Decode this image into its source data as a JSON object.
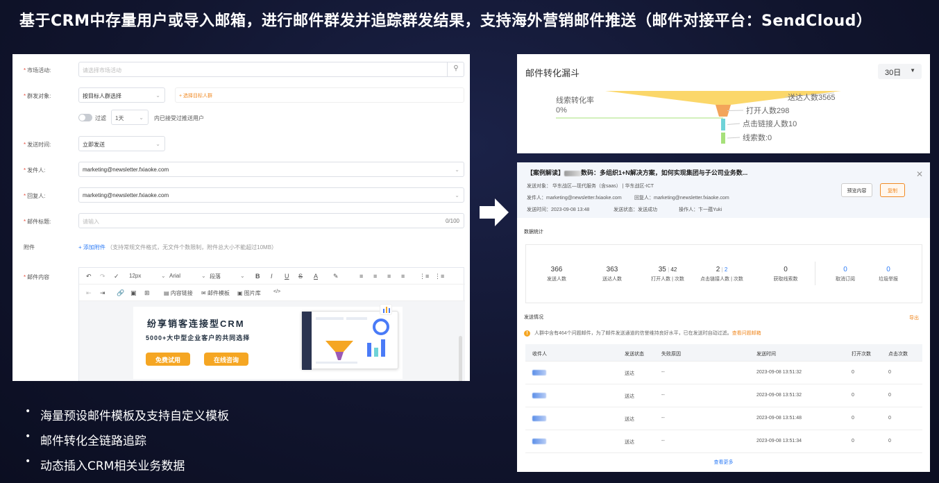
{
  "headline": "基于CRM中存量用户或导入邮箱，进行邮件群发并追踪群发结果，支持海外营销邮件推送（邮件对接平台：SendCloud）",
  "form": {
    "activity_label": "市场活动:",
    "activity_placeholder": "请选择市场活动",
    "target_label": "群发对象:",
    "target_value": "按目标人群选择",
    "target_link": "+ 选择目标人群",
    "filter_label": "过滤",
    "filter_days": "1天",
    "filter_note": "内已接受过推送用户",
    "time_label": "发送时间:",
    "time_value": "立即发送",
    "sender_label": "发件人:",
    "sender_value": "marketing@newsletter.fxiaoke.com",
    "reply_label": "回复人:",
    "reply_value": "marketing@newsletter.fxiaoke.com",
    "subject_label": "邮件标题:",
    "subject_placeholder": "请输入",
    "subject_count": "0/100",
    "attach_label": "附件",
    "attach_link": "+ 添加附件",
    "attach_note": "（支持常规文件格式，无文件个数限制，附件总大小不能超过10MB）",
    "content_label": "邮件内容",
    "toolbar": {
      "font_size": "12px",
      "font_family": "Arial",
      "paragraph": "段落",
      "content_link": "内容链接",
      "mail_template": "邮件模板",
      "image_lib": "图片库"
    },
    "banner": {
      "title": "纷享销客连接型CRM",
      "subtitle": "5000+大中型企业客户的共同选择",
      "btn_trial": "免费试用",
      "btn_consult": "在线咨询"
    }
  },
  "funnel": {
    "title": "邮件转化漏斗",
    "range": "30日",
    "conversion_label": "线索转化率",
    "conversion_value": "0%",
    "stages": [
      {
        "label": "送达人数3565",
        "value": 3565,
        "color": "#fbd76a"
      },
      {
        "label": "打开人数298",
        "value": 298,
        "color": "#f3a45a"
      },
      {
        "label": "点击链接人数10",
        "value": 10,
        "color": "#6fd3d8"
      },
      {
        "label": "线索数:0",
        "value": 0,
        "color": "#a6e07a"
      }
    ]
  },
  "detail": {
    "title": "【案例解读】",
    "title_tail": "数码：多组织1+N解决方案，如何实现集团与子公司业务数...",
    "target_line": "发送对象：  华东战区—现代服务（含saas） | 华东战区-ICT",
    "sender_line": "发件人：marketing@newsletter.fxiaoke.com",
    "reply_line": "回复人：marketing@newsletter.fxiaoke.com",
    "time_line": "发送时间：2023-09-08 13:48",
    "status_line": "发送状态：发送成功",
    "operator_line": "操作人：卞一蕴Yuki",
    "btn_preview": "预览内容",
    "btn_copy": "复制",
    "stats_title": "数据统计",
    "stats": [
      {
        "value": "366",
        "label": "发送人数"
      },
      {
        "value": "363",
        "label": "送达人数"
      },
      {
        "value": "35",
        "value2": "42",
        "label": "打开人数 | 次数"
      },
      {
        "value": "2",
        "value2": "2",
        "label": "点击链接人数 | 次数"
      },
      {
        "value": "0",
        "label": "获取线索数"
      },
      {
        "value": "0",
        "label": "取消订阅"
      },
      {
        "value": "0",
        "label": "垃圾举报"
      }
    ],
    "send_title": "发送情况",
    "export": "导出",
    "warning_text": "人群中含有464个问题邮件，为了邮件发送通道的信誉维持良好水平，已在发送时自动过滤。",
    "warning_link": "查看问题邮箱",
    "columns": [
      "收件人",
      "发送状态",
      "失败原因",
      "发送时间",
      "打开次数",
      "点击次数"
    ],
    "rows": [
      {
        "status": "送达",
        "reason": "--",
        "time": "2023-09-08 13:51:32",
        "opens": "0",
        "clicks": "0"
      },
      {
        "status": "送达",
        "reason": "--",
        "time": "2023-09-08 13:51:32",
        "opens": "0",
        "clicks": "0"
      },
      {
        "status": "送达",
        "reason": "--",
        "time": "2023-09-08 13:51:48",
        "opens": "0",
        "clicks": "0"
      },
      {
        "status": "送达",
        "reason": "--",
        "time": "2023-09-08 13:51:34",
        "opens": "0",
        "clicks": "0"
      }
    ],
    "more": "查看更多"
  },
  "bullets": [
    "海量预设邮件模板及支持自定义模板",
    "邮件转化全链路追踪",
    "动态插入CRM相关业务数据"
  ]
}
